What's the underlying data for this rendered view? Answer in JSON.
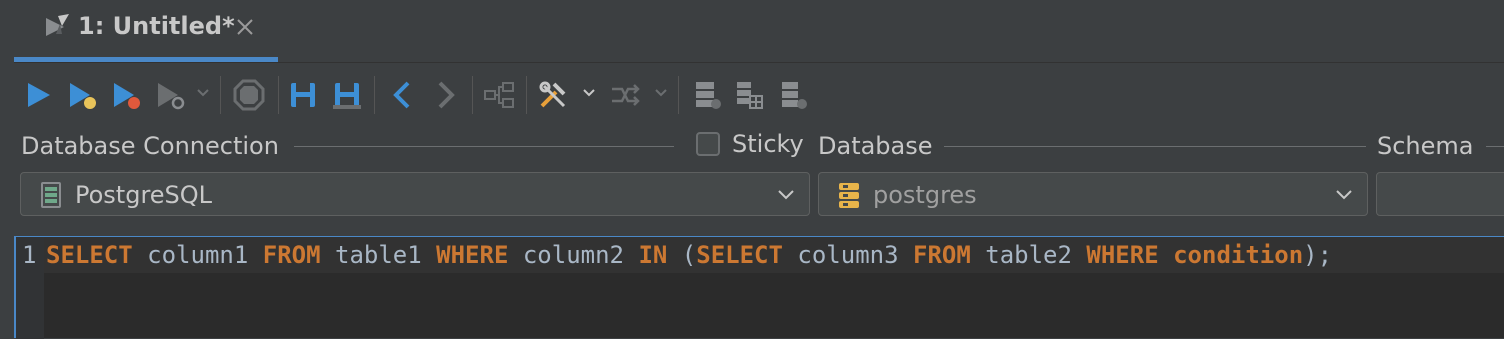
{
  "tab": {
    "title": "1: Untitled*"
  },
  "toolbar": {
    "buttons": [
      "execute-icon",
      "execute-current-icon",
      "execute-script-icon",
      "explain-plan-icon",
      "stop-icon",
      "save-icon",
      "save-as-icon",
      "back-icon",
      "forward-icon",
      "structure-icon",
      "tools-icon",
      "transaction-icon",
      "connect-db-icon",
      "db-table-icon",
      "db-settings-icon"
    ]
  },
  "connection": {
    "label": "Database Connection",
    "sticky_label": "Sticky",
    "sticky_checked": false,
    "value": "PostgreSQL"
  },
  "database": {
    "label": "Database",
    "value": "postgres"
  },
  "schema": {
    "label": "Schema",
    "value": ""
  },
  "editor": {
    "line_number": "1",
    "tokens": [
      {
        "t": "SELECT",
        "k": "kw"
      },
      {
        "t": " column1 ",
        "k": "id"
      },
      {
        "t": "FROM",
        "k": "kw"
      },
      {
        "t": " table1 ",
        "k": "id"
      },
      {
        "t": "WHERE",
        "k": "kw"
      },
      {
        "t": " column2 ",
        "k": "id"
      },
      {
        "t": "IN",
        "k": "kw"
      },
      {
        "t": " (",
        "k": "id"
      },
      {
        "t": "SELECT",
        "k": "kw"
      },
      {
        "t": " column3 ",
        "k": "id"
      },
      {
        "t": "FROM",
        "k": "kw"
      },
      {
        "t": " table2 ",
        "k": "id"
      },
      {
        "t": "WHERE",
        "k": "kw"
      },
      {
        "t": " ",
        "k": "id"
      },
      {
        "t": "condition",
        "k": "kw"
      },
      {
        "t": ");",
        "k": "id"
      }
    ]
  },
  "colors": {
    "accent": "#4a88c7",
    "run": "#3d8fd6",
    "keyword": "#cc7832",
    "background": "#3c3f41"
  }
}
